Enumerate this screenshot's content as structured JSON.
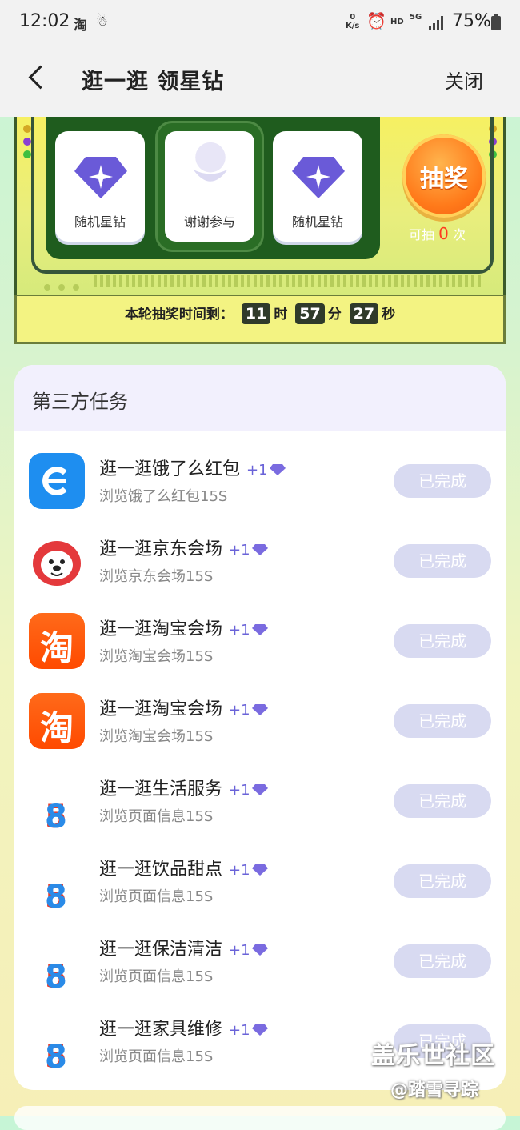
{
  "status_bar": {
    "time": "12:02",
    "net_speed_top": "0",
    "net_speed_unit": "K/s",
    "hd": "HD",
    "network": "5G",
    "battery": "75%"
  },
  "header": {
    "title": "逛一逛 领星钻",
    "close_label": "关闭"
  },
  "lottery": {
    "slots": [
      {
        "label": "随机星钻"
      },
      {
        "label": "谢谢参与"
      },
      {
        "label": "随机星钻"
      }
    ],
    "draw_button": "抽奖",
    "draws_prefix": "可抽",
    "draws_count": "0",
    "draws_suffix": "次",
    "timer_prefix": "本轮抽奖时间剩：",
    "hours": "11",
    "hours_unit": "时",
    "minutes": "57",
    "minutes_unit": "分",
    "seconds": "27",
    "seconds_unit": "秒"
  },
  "tasks": {
    "heading": "第三方任务",
    "items": [
      {
        "title": "逛一逛饿了么红包",
        "reward": "+1",
        "subtitle": "浏览饿了么红包15S",
        "button": "已完成",
        "icon": "eleme-icon"
      },
      {
        "title": "逛一逛京东会场",
        "reward": "+1",
        "subtitle": "浏览京东会场15S",
        "button": "已完成",
        "icon": "jd-icon"
      },
      {
        "title": "逛一逛淘宝会场",
        "reward": "+1",
        "subtitle": "浏览淘宝会场15S",
        "button": "已完成",
        "icon": "taobao-icon",
        "icon_text": "淘"
      },
      {
        "title": "逛一逛淘宝会场",
        "reward": "+1",
        "subtitle": "浏览淘宝会场15S",
        "button": "已完成",
        "icon": "taobao-icon",
        "icon_text": "淘"
      },
      {
        "title": "逛一逛生活服务",
        "reward": "+1",
        "subtitle": "浏览页面信息15S",
        "button": "已完成",
        "icon": "58-icon",
        "icon_text_a": "5",
        "icon_text_b": "8"
      },
      {
        "title": "逛一逛饮品甜点",
        "reward": "+1",
        "subtitle": "浏览页面信息15S",
        "button": "已完成",
        "icon": "58-icon",
        "icon_text_a": "5",
        "icon_text_b": "8"
      },
      {
        "title": "逛一逛保洁清洁",
        "reward": "+1",
        "subtitle": "浏览页面信息15S",
        "button": "已完成",
        "icon": "58-icon",
        "icon_text_a": "5",
        "icon_text_b": "8"
      },
      {
        "title": "逛一逛家具维修",
        "reward": "+1",
        "subtitle": "浏览页面信息15S",
        "button": "已完成",
        "icon": "58-icon",
        "icon_text_a": "5",
        "icon_text_b": "8"
      }
    ]
  },
  "watermark": {
    "line1": "盖乐世社区",
    "line2": "@踏雪寻踪"
  },
  "colors": {
    "accent": "#6a63d8",
    "button_done": "#d8daf1",
    "slot_panel": "#1f5c1e",
    "draw_button": "#ff7a1a"
  }
}
